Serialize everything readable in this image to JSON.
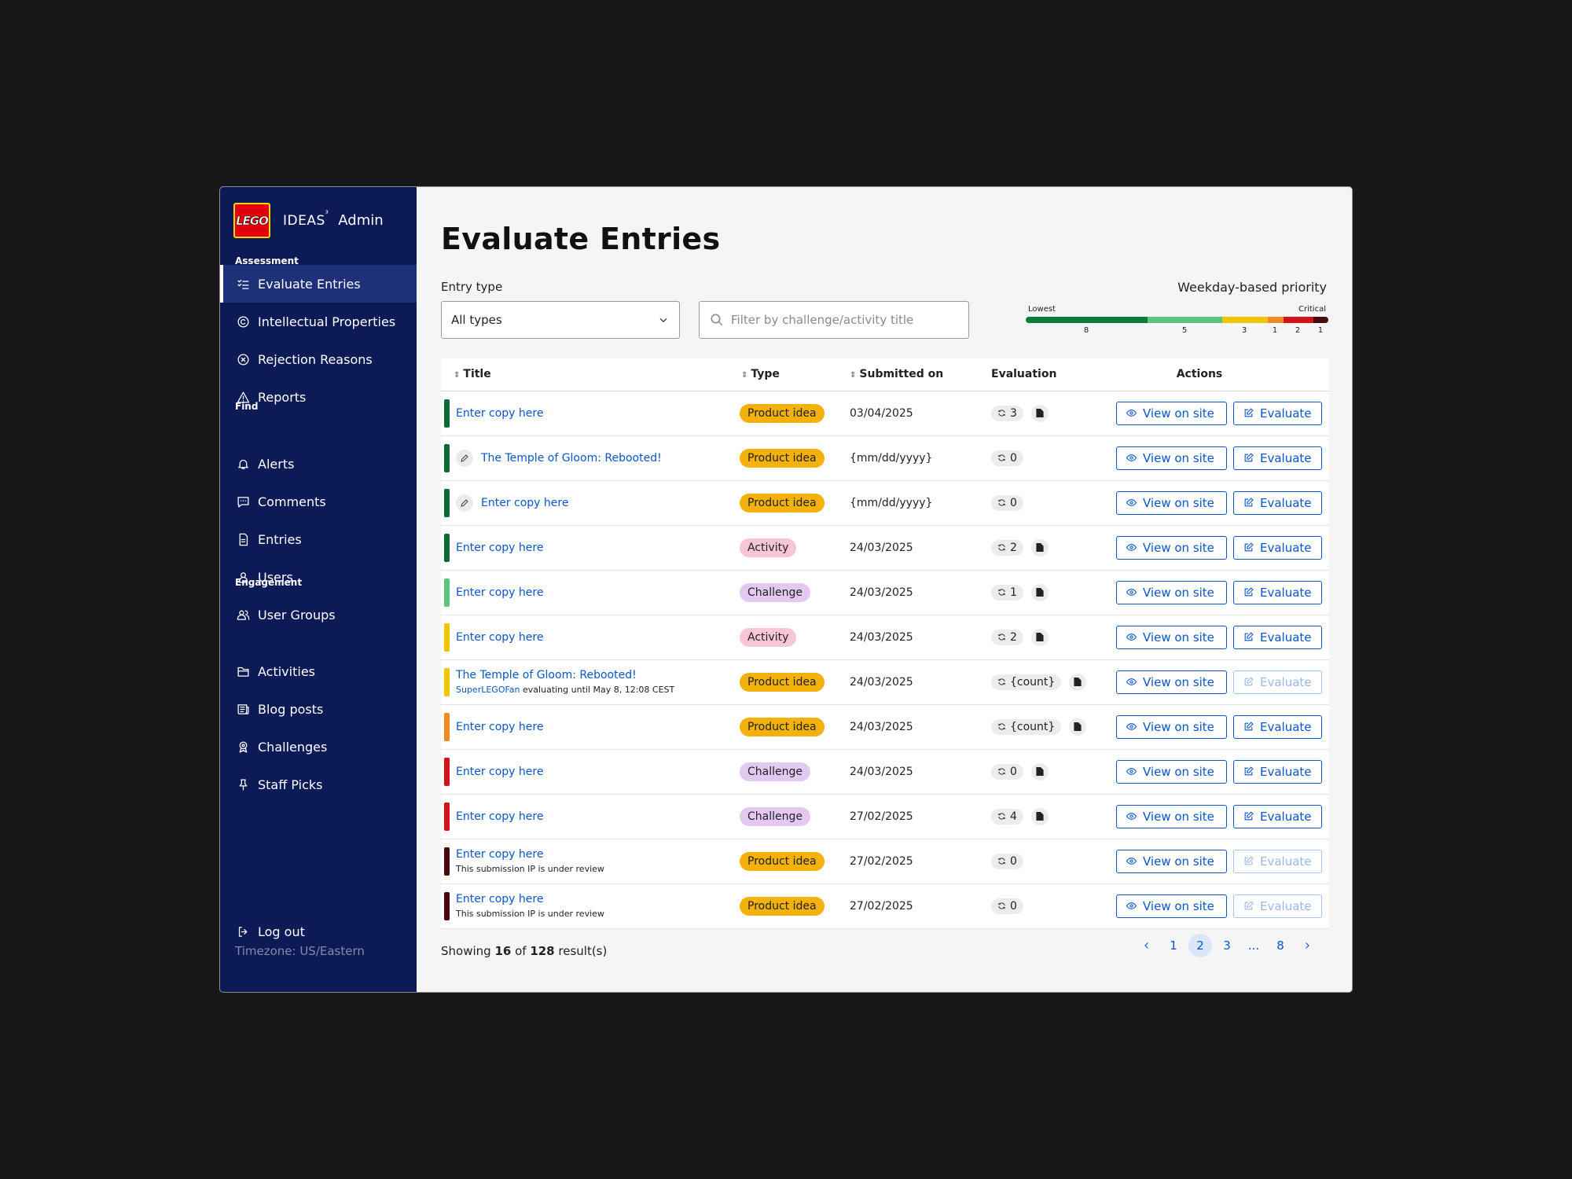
{
  "brand": {
    "logo_text": "LEGO",
    "ideas": "IDEAS",
    "ideas_mark": "³",
    "admin": "Admin"
  },
  "sidebar": {
    "sections": [
      "Assessment",
      "Find",
      "Engagement"
    ],
    "items": [
      {
        "label": "Evaluate Entries",
        "icon": "checklist-icon",
        "active": true
      },
      {
        "label": "Intellectual Properties",
        "icon": "copyright-icon"
      },
      {
        "label": "Rejection Reasons",
        "icon": "x-circle-icon"
      },
      {
        "label": "Reports",
        "icon": "warning-icon"
      },
      {
        "label": "Alerts",
        "icon": "bell-icon"
      },
      {
        "label": "Comments",
        "icon": "comment-icon"
      },
      {
        "label": "Entries",
        "icon": "document-icon"
      },
      {
        "label": "Users",
        "icon": "user-icon"
      },
      {
        "label": "User Groups",
        "icon": "users-icon"
      },
      {
        "label": "Activities",
        "icon": "folder-icon"
      },
      {
        "label": "Blog posts",
        "icon": "newspaper-icon"
      },
      {
        "label": "Challenges",
        "icon": "award-icon"
      },
      {
        "label": "Staff Picks",
        "icon": "pin-icon"
      }
    ],
    "logout": "Log out",
    "timezone": "Timezone: US/Eastern"
  },
  "page": {
    "title": "Evaluate Entries"
  },
  "filters": {
    "entry_type_label": "Entry type",
    "entry_type_value": "All types",
    "search_placeholder": "Filter by challenge/activity title"
  },
  "priority": {
    "title": "Weekday-based priority",
    "low_label": "Lowest",
    "high_label": "Critical",
    "segments": [
      {
        "count": "8",
        "color": "#0b7a3b"
      },
      {
        "count": "5",
        "color": "#5cc47c"
      },
      {
        "count": "3",
        "color": "#f3c400"
      },
      {
        "count": "1",
        "color": "#f08a24"
      },
      {
        "count": "2",
        "color": "#d4141c"
      },
      {
        "count": "1",
        "color": "#4a0a10"
      }
    ]
  },
  "table": {
    "headers": {
      "title": "Title",
      "type": "Type",
      "submitted": "Submitted on",
      "evaluation": "Evaluation",
      "actions": "Actions"
    },
    "view_label": "View on site",
    "evaluate_label": "Evaluate",
    "rows": [
      {
        "color": "#0b6b35",
        "title": "Enter copy here",
        "type": "Product idea",
        "date": "03/04/2025",
        "count": "3",
        "doc": true
      },
      {
        "color": "#0b6b35",
        "pencil": true,
        "title": "The Temple of Gloom: Rebooted!",
        "type": "Product idea",
        "date": "{mm/dd/yyyy}",
        "count": "0"
      },
      {
        "color": "#0b6b35",
        "pencil": true,
        "title": "Enter copy here",
        "type": "Product idea",
        "date": "{mm/dd/yyyy}",
        "count": "0"
      },
      {
        "color": "#0b6b35",
        "title": "Enter copy here",
        "type": "Activity",
        "date": "24/03/2025",
        "count": "2",
        "doc": true
      },
      {
        "color": "#5cc47c",
        "title": "Enter copy here",
        "type": "Challenge",
        "date": "24/03/2025",
        "count": "1",
        "doc": true
      },
      {
        "color": "#f3c400",
        "title": "Enter copy here",
        "type": "Activity",
        "date": "24/03/2025",
        "count": "2",
        "doc": true
      },
      {
        "color": "#f3c400",
        "title": "The Temple of Gloom: Rebooted!",
        "sub_user": "SuperLEGOFan",
        "sub_text": " evaluating until May 8, 12:08 CEST",
        "type": "Product idea",
        "date": "24/03/2025",
        "count": "{count}",
        "doc": true,
        "eval_disabled": true
      },
      {
        "color": "#f08a24",
        "title": "Enter copy here",
        "type": "Product idea",
        "date": "24/03/2025",
        "count": "{count}",
        "doc": true
      },
      {
        "color": "#d4141c",
        "title": "Enter copy here",
        "type": "Challenge",
        "date": "24/03/2025",
        "count": "0",
        "doc": true
      },
      {
        "color": "#d4141c",
        "title": "Enter copy here",
        "type": "Challenge",
        "date": "27/02/2025",
        "count": "4",
        "doc": true
      },
      {
        "color": "#4a0a10",
        "title": "Enter copy here",
        "sub_text": "This submission IP is under review",
        "type": "Product idea",
        "date": "27/02/2025",
        "count": "0",
        "eval_disabled": true
      },
      {
        "color": "#4a0a10",
        "title": "Enter copy here",
        "sub_text": "This submission IP is under review",
        "type": "Product idea",
        "date": "27/02/2025",
        "count": "0",
        "eval_disabled": true
      }
    ]
  },
  "footer": {
    "showing_prefix": "Showing ",
    "showing_count": "16",
    "showing_of": " of ",
    "showing_total": "128",
    "showing_suffix": " result(s)",
    "pages": [
      "1",
      "2",
      "3",
      "...",
      "8"
    ],
    "current_page": "2"
  }
}
